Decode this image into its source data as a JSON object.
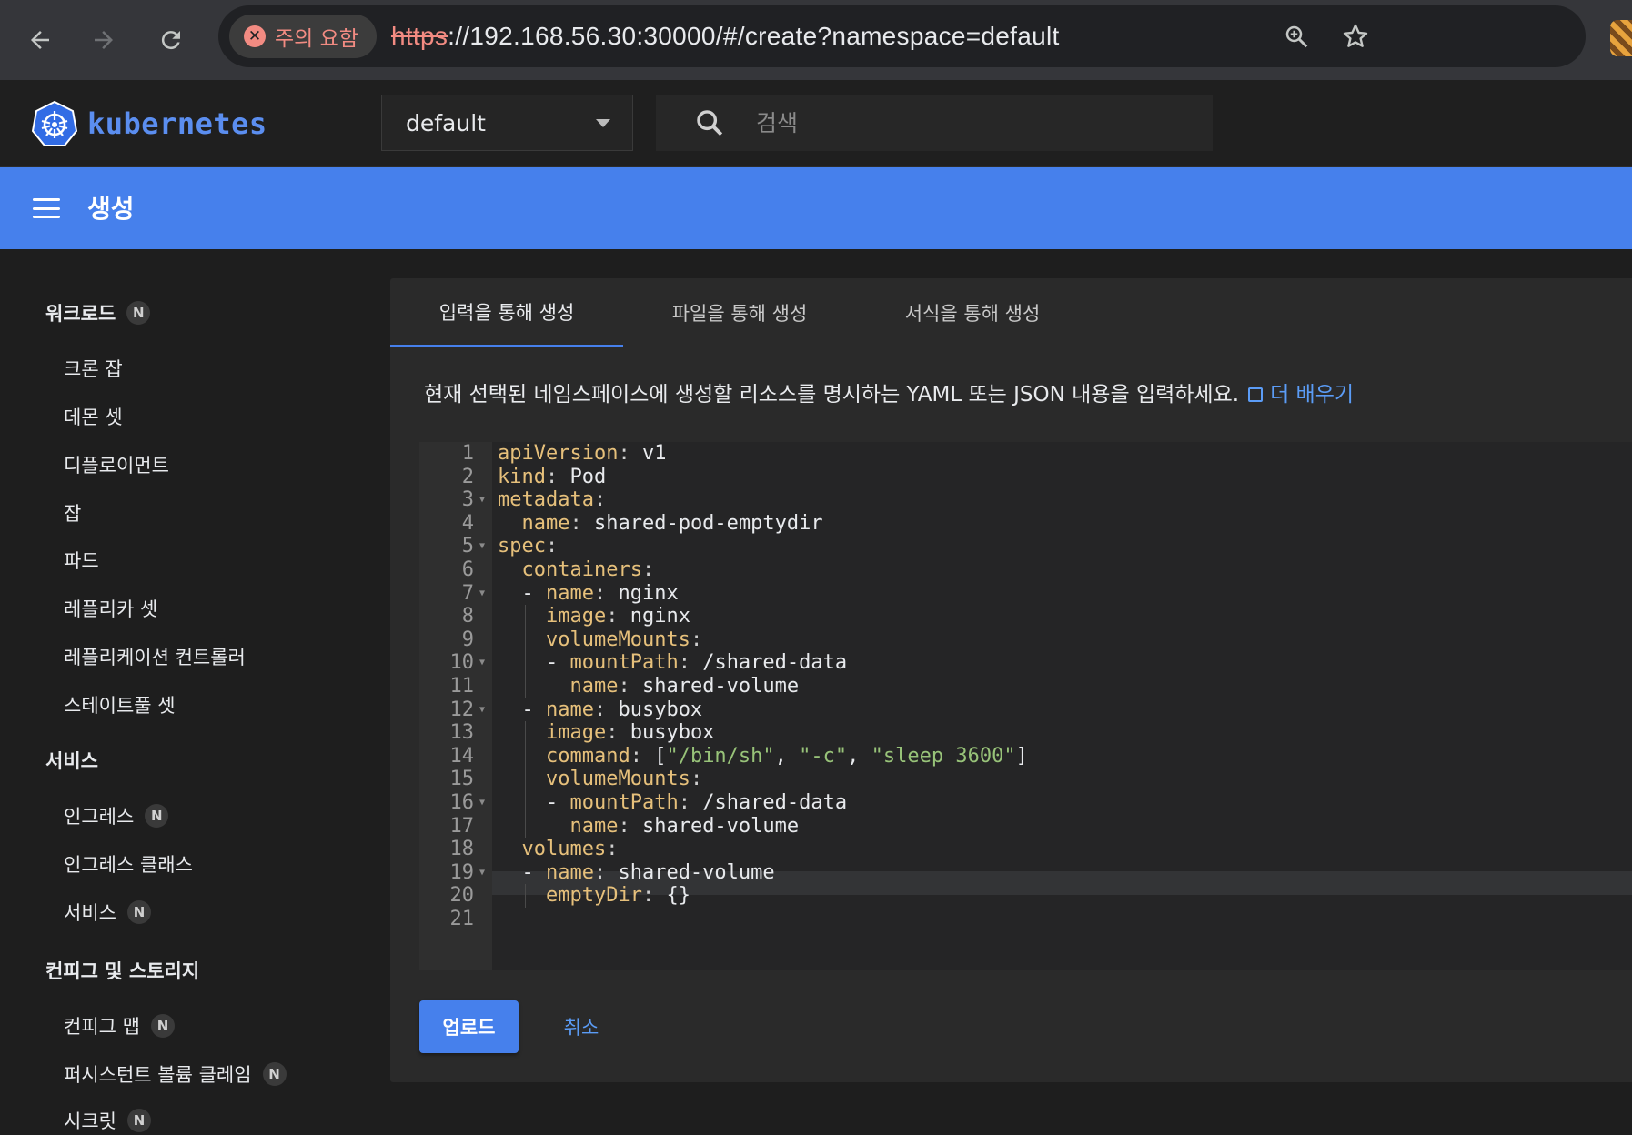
{
  "browser": {
    "security_chip": "주의 요함",
    "url_scheme": "https",
    "url_rest": "://192.168.56.30:30000/#/create?namespace=default",
    "icons": [
      "back-icon",
      "forward-icon",
      "reload-icon",
      "zoom-icon",
      "bookmark-star-icon"
    ]
  },
  "header": {
    "logo_text": "kubernetes",
    "namespace": "default",
    "search_placeholder": "검색"
  },
  "title_bar": {
    "title": "생성"
  },
  "sidebar": {
    "groups": [
      {
        "label": "워크로드",
        "badge": "N",
        "items": [
          {
            "label": "크론 잡"
          },
          {
            "label": "데몬 셋"
          },
          {
            "label": "디플로이먼트"
          },
          {
            "label": "잡"
          },
          {
            "label": "파드"
          },
          {
            "label": "레플리카 셋"
          },
          {
            "label": "레플리케이션 컨트롤러"
          },
          {
            "label": "스테이트풀 셋"
          }
        ]
      },
      {
        "label": "서비스",
        "badge": "",
        "items": [
          {
            "label": "인그레스",
            "badge": "N"
          },
          {
            "label": "인그레스 클래스"
          },
          {
            "label": "서비스",
            "badge": "N"
          }
        ]
      },
      {
        "label": "컨피그 및 스토리지",
        "badge": "",
        "items": [
          {
            "label": "컨피그 맵",
            "badge": "N"
          },
          {
            "label": "퍼시스턴트 볼륨 클레임",
            "badge": "N"
          },
          {
            "label": "시크릿",
            "badge": "N"
          }
        ]
      }
    ]
  },
  "main": {
    "tabs": [
      {
        "label": "입력을 통해 생성",
        "active": true
      },
      {
        "label": "파일을 통해 생성",
        "active": false
      },
      {
        "label": "서식을 통해 생성",
        "active": false
      }
    ],
    "description": "현재 선택된 네임스페이스에 생성할 리소스를 명시하는 YAML 또는 JSON 내용을 입력하세요.",
    "learn_more": "더 배우기",
    "editor_lines": [
      "apiVersion: v1",
      "kind: Pod",
      "metadata:",
      "  name: shared-pod-emptydir",
      "spec:",
      "  containers:",
      "  - name: nginx",
      "    image: nginx",
      "    volumeMounts:",
      "    - mountPath: /shared-data",
      "      name: shared-volume",
      "  - name: busybox",
      "    image: busybox",
      "    command: [\"/bin/sh\", \"-c\", \"sleep 3600\"]",
      "    volumeMounts:",
      "    - mountPath: /shared-data",
      "      name: shared-volume",
      "  volumes:",
      "  - name: shared-volume",
      "    emptyDir: {}",
      ""
    ],
    "fold_lines": [
      3,
      5,
      7,
      10,
      12,
      16,
      19
    ],
    "upload_label": "업로드",
    "cancel_label": "취소"
  },
  "colors": {
    "accent": "#4680ec",
    "link": "#5b9cf6",
    "yaml_key": "#e6c07b",
    "yaml_string": "#98c379",
    "warning": "#f28b82"
  }
}
